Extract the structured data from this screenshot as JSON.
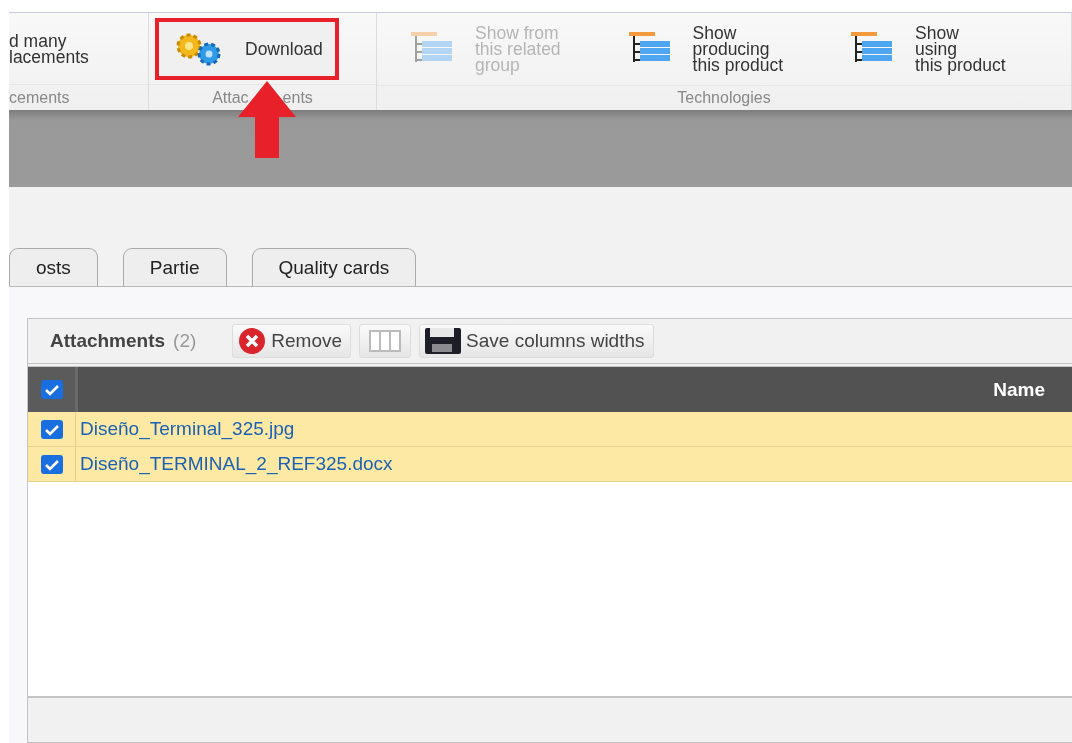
{
  "ribbon": {
    "groups": [
      {
        "label": [
          "cements"
        ],
        "buttons": [
          {
            "label": "d many\nlacements",
            "kind": "text",
            "disabled": false,
            "highlighted": false
          }
        ]
      },
      {
        "label": [
          "Attac",
          "ents"
        ],
        "buttons": [
          {
            "label": "Download",
            "kind": "gears",
            "disabled": false,
            "highlighted": true
          }
        ]
      },
      {
        "label": [
          "Technologies"
        ],
        "buttons": [
          {
            "label": "Show from\nthis related\ngroup",
            "kind": "tree",
            "disabled": true,
            "highlighted": false
          },
          {
            "label": "Show\nproducing\nthis product",
            "kind": "tree",
            "disabled": false,
            "highlighted": false
          },
          {
            "label": "Show\nusing\nthis product",
            "kind": "tree",
            "disabled": false,
            "highlighted": false
          }
        ]
      }
    ],
    "annotation_arrow": true
  },
  "tabs": [
    {
      "label": "osts",
      "selected": false
    },
    {
      "label": "Partie",
      "selected": false
    },
    {
      "label": "Quality cards",
      "selected": false
    }
  ],
  "attachments": {
    "title": "Attachments",
    "count": "(2)",
    "toolbar": [
      {
        "kind": "remove",
        "label": "Remove"
      },
      {
        "kind": "columns"
      },
      {
        "kind": "save",
        "label": "Save columns widths"
      }
    ],
    "header_checked": true,
    "columns": [
      "Name"
    ],
    "rows": [
      {
        "name": "Diseño_Terminal_325.jpg",
        "checked": true
      },
      {
        "name": "Diseño_TERMINAL_2_REF325.docx",
        "checked": true
      }
    ]
  }
}
